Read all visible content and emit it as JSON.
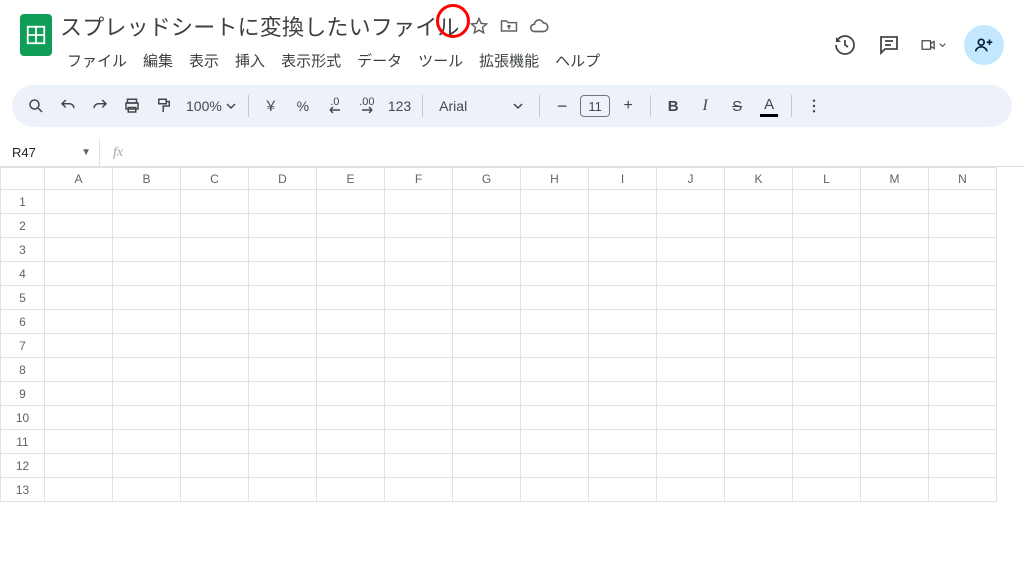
{
  "header": {
    "title": "スプレッドシートに変換したいファイル",
    "menus": [
      "ファイル",
      "編集",
      "表示",
      "挿入",
      "表示形式",
      "データ",
      "ツール",
      "拡張機能",
      "ヘルプ"
    ]
  },
  "toolbar": {
    "zoom": "100%",
    "currency": "￥",
    "percent": "%",
    "dec_dec": ".0",
    "inc_dec": ".00",
    "number_format": "123",
    "font": "Arial",
    "minus": "−",
    "font_size": "11",
    "plus": "+",
    "bold": "B",
    "italic": "I",
    "strike": "S",
    "text_color": "A"
  },
  "namebox": {
    "cell": "R47",
    "fx": "fx"
  },
  "grid": {
    "cols": [
      "A",
      "B",
      "C",
      "D",
      "E",
      "F",
      "G",
      "H",
      "I",
      "J",
      "K",
      "L",
      "M",
      "N"
    ],
    "rows": [
      "1",
      "2",
      "3",
      "4",
      "5",
      "6",
      "7",
      "8",
      "9",
      "10",
      "11",
      "12",
      "13"
    ]
  }
}
